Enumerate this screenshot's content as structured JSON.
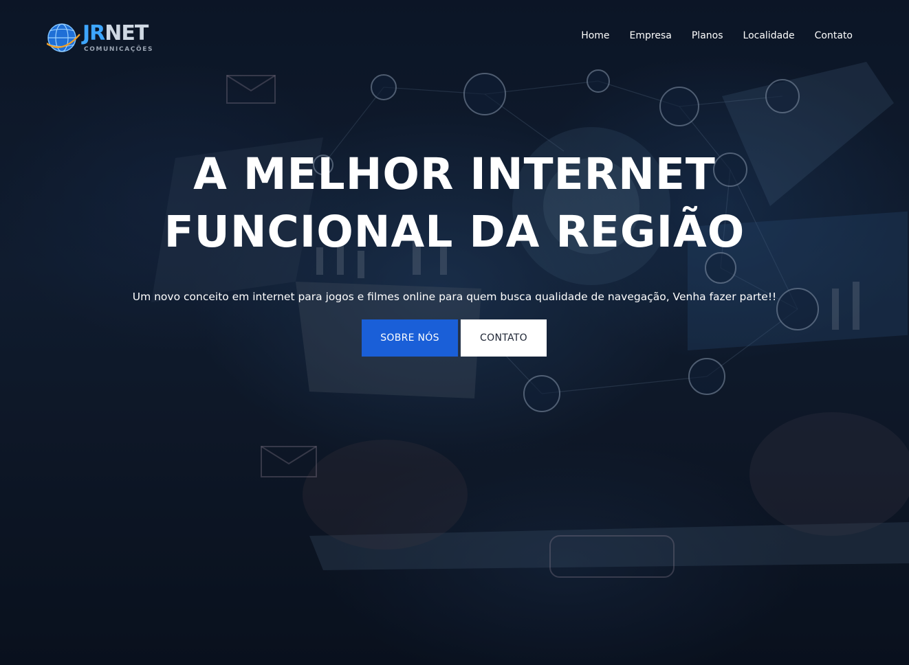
{
  "brand": {
    "name_part1": "JR",
    "name_part2": "NET",
    "tagline": "COMUNICAÇÕES",
    "color_primary": "#3ea6ff",
    "color_secondary": "#cfd8e3"
  },
  "nav": {
    "items": [
      {
        "label": "Home"
      },
      {
        "label": "Empresa"
      },
      {
        "label": "Planos"
      },
      {
        "label": "Localidade"
      },
      {
        "label": "Contato"
      }
    ]
  },
  "hero": {
    "headline_line1": "A MELHOR INTERNET",
    "headline_line2": "FUNCIONAL DA REGIÃO",
    "subtitle": "Um novo conceito em internet para jogos e filmes online para quem busca qualidade de navegação, Venha fazer parte!!",
    "primary_button": "SOBRE NÓS",
    "secondary_button": "CONTATO",
    "accent_color": "#1a5fd8"
  }
}
